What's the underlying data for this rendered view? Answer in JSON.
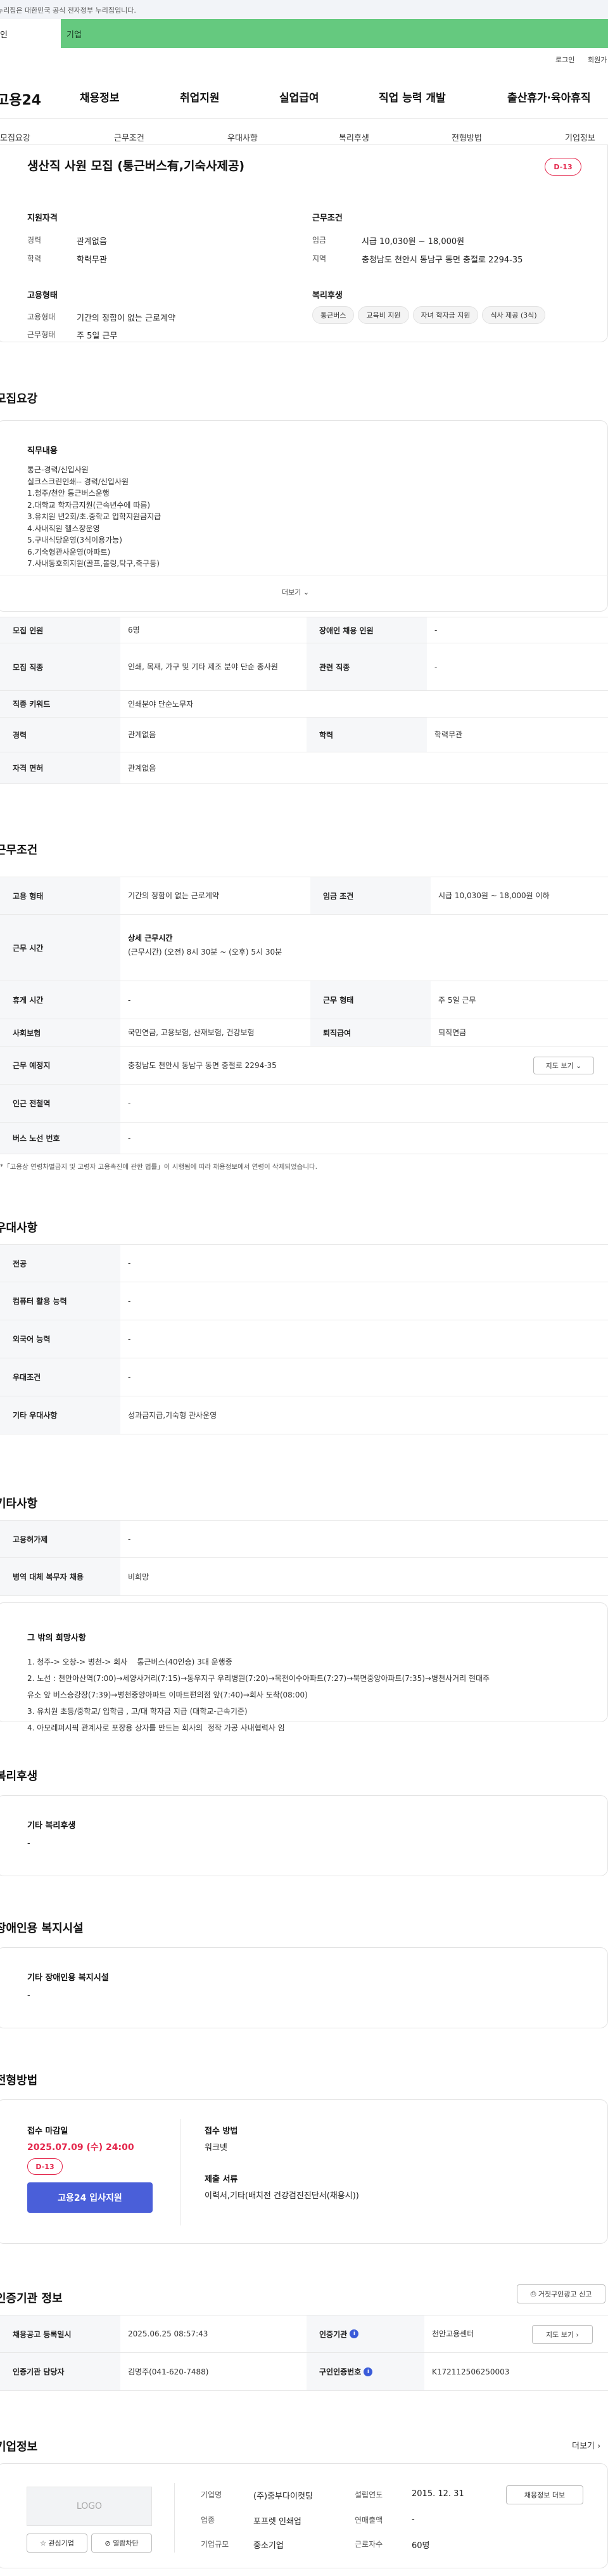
{
  "gov_notice": "누리집은 대한민국 공식 전자정부 누리집입니다.",
  "topbar": {
    "personal": "인",
    "business": "기업"
  },
  "util": {
    "login": "로그인",
    "join": "회원가"
  },
  "logo": "고용24",
  "gnb": [
    "채용정보",
    "취업지원",
    "실업급여",
    "직업 능력 개발",
    "출산휴가·육아휴직"
  ],
  "subnav": [
    "모집요강",
    "근무조건",
    "우대사항",
    "복리후생",
    "전형방법",
    "기업정보"
  ],
  "job": {
    "title": "생산직 사원 모집 (통근버스有,기숙사제공)",
    "dday": "D-13",
    "qual_title": "지원자격",
    "cond_title": "근무조건",
    "career_label": "경력",
    "career": "관계없음",
    "edu_label": "학력",
    "edu": "학력무관",
    "wage_label": "임금",
    "wage": "시급 10,030원 ~ 18,000원",
    "region_label": "지역",
    "region": "충청남도 천안시 동남구 동면 충절로 2294-35",
    "emp_title": "고용형태",
    "welfare_title": "복리후생",
    "emptype_label": "고용형태",
    "emptype": "기간의 정함이 없는 근로계약",
    "worktype_label": "근무형태",
    "worktype": "주 5일 근무",
    "chips": [
      "통근버스",
      "교육비 지원",
      "자녀 학자금 지원",
      "식사 제공 (3식)"
    ]
  },
  "recruit": {
    "section_title": "모집요강",
    "duty_title": "직무내용",
    "duty_lines": [
      "통근-경력/신입사원",
      "실크스크린인쇄-- 경력/신입사원",
      "1.청주/천안 통근버스운행",
      "2.대학교 학자금지원(근속년수에 따름)",
      "3.유치원 년2회/초.중학교 입학지원금지급",
      "4.사내직원 헬스장운영",
      "5.구내식당운영(3식이용가능)",
      "6.기숙형관사운영(아파트)",
      "7.사내동호회지원(골프,볼링,탁구,축구등)"
    ],
    "more": "더보기",
    "rows": [
      {
        "l1": "모집 인원",
        "v1": "6명",
        "l2": "장애인 채용 인원",
        "v2": "-"
      },
      {
        "l1": "모집 직종",
        "v1": "인쇄, 목재, 가구 및 기타 제조 분야 단순 종사원",
        "l2": "관련 직종",
        "v2": "-"
      },
      {
        "l1": "직종 키워드",
        "v1": "인쇄분야 단순노무자",
        "l2": "",
        "v2": ""
      },
      {
        "l1": "경력",
        "v1": "관계없음",
        "l2": "학력",
        "v2": "학력무관"
      },
      {
        "l1": "자격 면허",
        "v1": "관계없음",
        "l2": "",
        "v2": ""
      }
    ]
  },
  "condition": {
    "section_title": "근무조건",
    "emptype_label": "고용 형태",
    "emptype": "기간의 정함이 없는 근로계약",
    "wage_label": "임금 조건",
    "wage": "시급 10,030원 ~ 18,000원 이하",
    "time_label": "근무 시간",
    "time_title": "상세 근무시간",
    "time_detail": "(근무시간) (오전) 8시 30분 ~ (오후) 5시 30분",
    "break_label": "휴게 시간",
    "break": "-",
    "worktype_label": "근무 형태",
    "worktype": "주 5일 근무",
    "insurance_label": "사회보험",
    "insurance": "국민연금, 고용보험, 산재보험, 건강보험",
    "retire_label": "퇴직급여",
    "retire": "퇴직연금",
    "place_label": "근무 예정지",
    "place": "충청남도 천안시 동남구 동면 충절로 2294-35",
    "map_btn": "지도 보기",
    "subway_label": "인근 전철역",
    "subway": "-",
    "bus_label": "버스 노선 번호",
    "bus": "-",
    "notice": "*「고용상 연령차별금지 및 고령자 고용촉진에 관한 법률」이 시행됨에 따라 채용정보에서 연령이 삭제되었습니다."
  },
  "pref": {
    "section_title": "우대사항",
    "rows": [
      {
        "label": "전공",
        "value": "-"
      },
      {
        "label": "컴퓨터 활용 능력",
        "value": "-"
      },
      {
        "label": "외국어 능력",
        "value": "-"
      },
      {
        "label": "우대조건",
        "value": "-"
      },
      {
        "label": "기타 우대사항",
        "value": "성과금지급,기숙형 관사운영"
      }
    ]
  },
  "etc": {
    "section_title": "기타사항",
    "rows": [
      {
        "label": "고용허가제",
        "value": "-"
      },
      {
        "label": "병역 대체 복무자 채용",
        "value": "비희망"
      }
    ],
    "hope_title": "그 밖의 희망사항",
    "hope_lines": [
      "1. 청주-> 오창-> 병천-> 회사    통근버스(40인승) 3대 운행중",
      "2. 노선 : 천안아산역(7:00)→세양사거리(7:15)→동우지구 우리병원(7:20)→목천이수아파트(7:27)→북면중앙아파트(7:35)→병천사거리 현대주",
      "유소 앞 버스승강장(7:39)→병천중앙아파트 이마트편의점 앞(7:40)→회사 도착(08:00)",
      "3. 유치원 초등/중학교/ 입학금 , 고/대 학자금 지급 (대학교-근속기준)",
      "4. 아모레퍼시픽 관계사로 포장용 상자를 만드는 회사의  정작 가공 사내협력사 임"
    ]
  },
  "welfare": {
    "section_title": "복리후생",
    "box_title": "기타 복리후생",
    "box_value": "-"
  },
  "disabled": {
    "section_title": "장애인용 복지시설",
    "box_title": "기타 장애인용 복지시설",
    "box_value": "-"
  },
  "apply": {
    "section_title": "전형방법",
    "deadline_label": "접수 마감일",
    "deadline": "2025.07.09 (수) 24:00",
    "dday": "D-13",
    "apply_btn": "고용24 입사지원",
    "method_label": "접수 방법",
    "method": "워크넷",
    "docs_label": "제출 서류",
    "docs": "이력서,기타(배치전 건강검진진단서(채용시))"
  },
  "agency": {
    "section_title": "인증기관 정보",
    "report_btn": "거짓구인광고 신고",
    "reg_label": "채용공고 등록일시",
    "reg": "2025.06.25 08:57:43",
    "org_label": "인증기관",
    "org": "천안고용센터",
    "map_btn": "지도 보기",
    "mgr_label": "인증기관 담당자",
    "mgr": "김명주(041-620-7488)",
    "id_label": "구인인증번호",
    "id": "K172112506250003"
  },
  "company": {
    "section_title": "기업정보",
    "more": "더보기",
    "logo_ph": "LOGO",
    "fav_btn": "관심기업",
    "block_btn": "열람차단",
    "name_label": "기업명",
    "name": "(주)중부다이컷팅",
    "found_label": "설립연도",
    "found": "2015. 12. 31",
    "jobs_btn": "채용정보 더보",
    "ind_label": "업종",
    "ind": "포프렛 인쇄업",
    "sales_label": "연매출액",
    "sales": "-",
    "size_label": "기업규모",
    "size": "중소기업",
    "staff_label": "근로자수",
    "staff": "60명"
  }
}
